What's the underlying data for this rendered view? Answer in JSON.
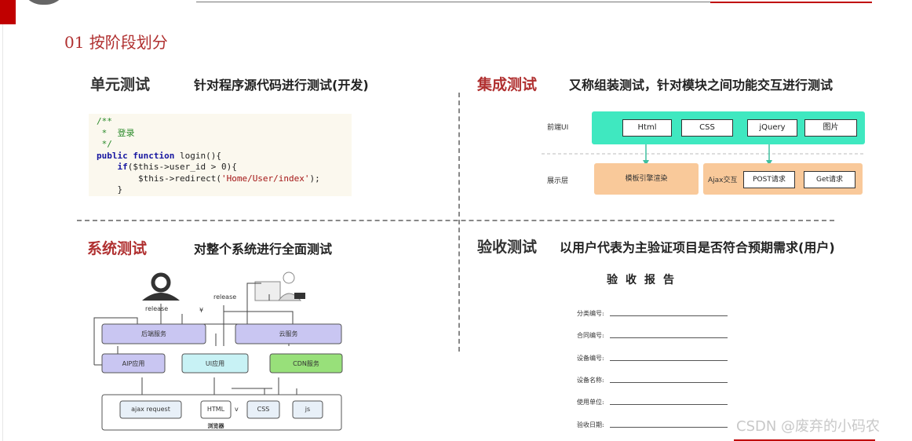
{
  "heading": "01  按阶段划分",
  "unit": {
    "title": "单元测试",
    "desc": "针对程序源代码进行测试(开发)"
  },
  "integration": {
    "title": "集成测试",
    "desc": "又称组装测试，针对模块之间功能交互进行测试"
  },
  "system": {
    "title": "系统测试",
    "desc": "对整个系统进行全面测试"
  },
  "acceptance": {
    "title": "验收测试",
    "desc": "以用户代表为主验证项目是否符合预期需求(用户)"
  },
  "code": {
    "line1": "/**",
    "line2": " *  登录",
    "line3": " */",
    "kw1": "public function",
    "fn": " login(){",
    "if_kw": "if",
    "if_rest": "($this->user_id > 0){",
    "redirect": "$this->redirect(",
    "redirect_str": "'Home/User/index'",
    "redirect_end": ");",
    "close1": "}"
  },
  "integration_diagram": {
    "front_label": "前端UI",
    "front_items": [
      "Html",
      "CSS",
      "jQuery",
      "图片"
    ],
    "display_label": "展示层",
    "template": "模板引擎渲染",
    "ajax": "Ajax交互",
    "post": "POST请求",
    "get": "Get请求"
  },
  "system_diagram": {
    "release1": "release",
    "release2": "release",
    "mark": "¥",
    "backend": "后端服务",
    "cloud": "云服务",
    "aip": "AIP应用",
    "ui": "UI应用",
    "cdn": "CDN服务",
    "ajax": "ajax request",
    "html": "HTML",
    "v": "v",
    "css": "CSS",
    "js": "js",
    "browser": "浏览器"
  },
  "report": {
    "title": "验收报告",
    "fields": [
      "分类编号:",
      "合同编号:",
      "设备编号:",
      "设备名称:",
      "使用单位:",
      "验收日期:"
    ]
  },
  "watermark": "CSDN @废弃的小码农",
  "colors": {
    "accent_red": "#c00000",
    "heading_red": "#b03030",
    "teal": "#3fe8c0",
    "orange": "#f9c99a",
    "purple": "#c9c6f2",
    "cyan": "#c8f2f5",
    "green": "#98e07a"
  }
}
